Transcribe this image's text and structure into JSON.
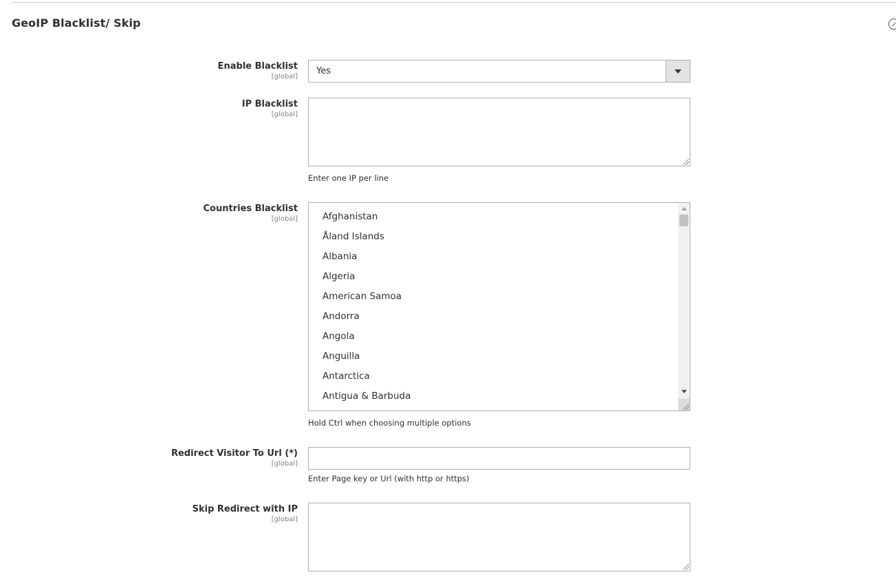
{
  "section": {
    "title": "GeoIP Blacklist/ Skip",
    "collapse_icon": "collapse-circle-icon"
  },
  "fields": {
    "enable_blacklist": {
      "label": "Enable Blacklist",
      "scope": "[global]",
      "value": "Yes"
    },
    "ip_blacklist": {
      "label": "IP Blacklist",
      "scope": "[global]",
      "value": "",
      "note": "Enter one IP per line"
    },
    "countries_blacklist": {
      "label": "Countries Blacklist",
      "scope": "[global]",
      "options": [
        "Afghanistan",
        "Åland Islands",
        "Albania",
        "Algeria",
        "American Samoa",
        "Andorra",
        "Angola",
        "Anguilla",
        "Antarctica",
        "Antigua & Barbuda"
      ],
      "note": "Hold Ctrl when choosing multiple options"
    },
    "redirect_url": {
      "label": "Redirect Visitor To Url (*)",
      "scope": "[global]",
      "value": "",
      "note": "Enter Page key or Url (with http or https)"
    },
    "skip_redirect_ip": {
      "label": "Skip Redirect with IP",
      "scope": "[global]",
      "value": ""
    }
  }
}
